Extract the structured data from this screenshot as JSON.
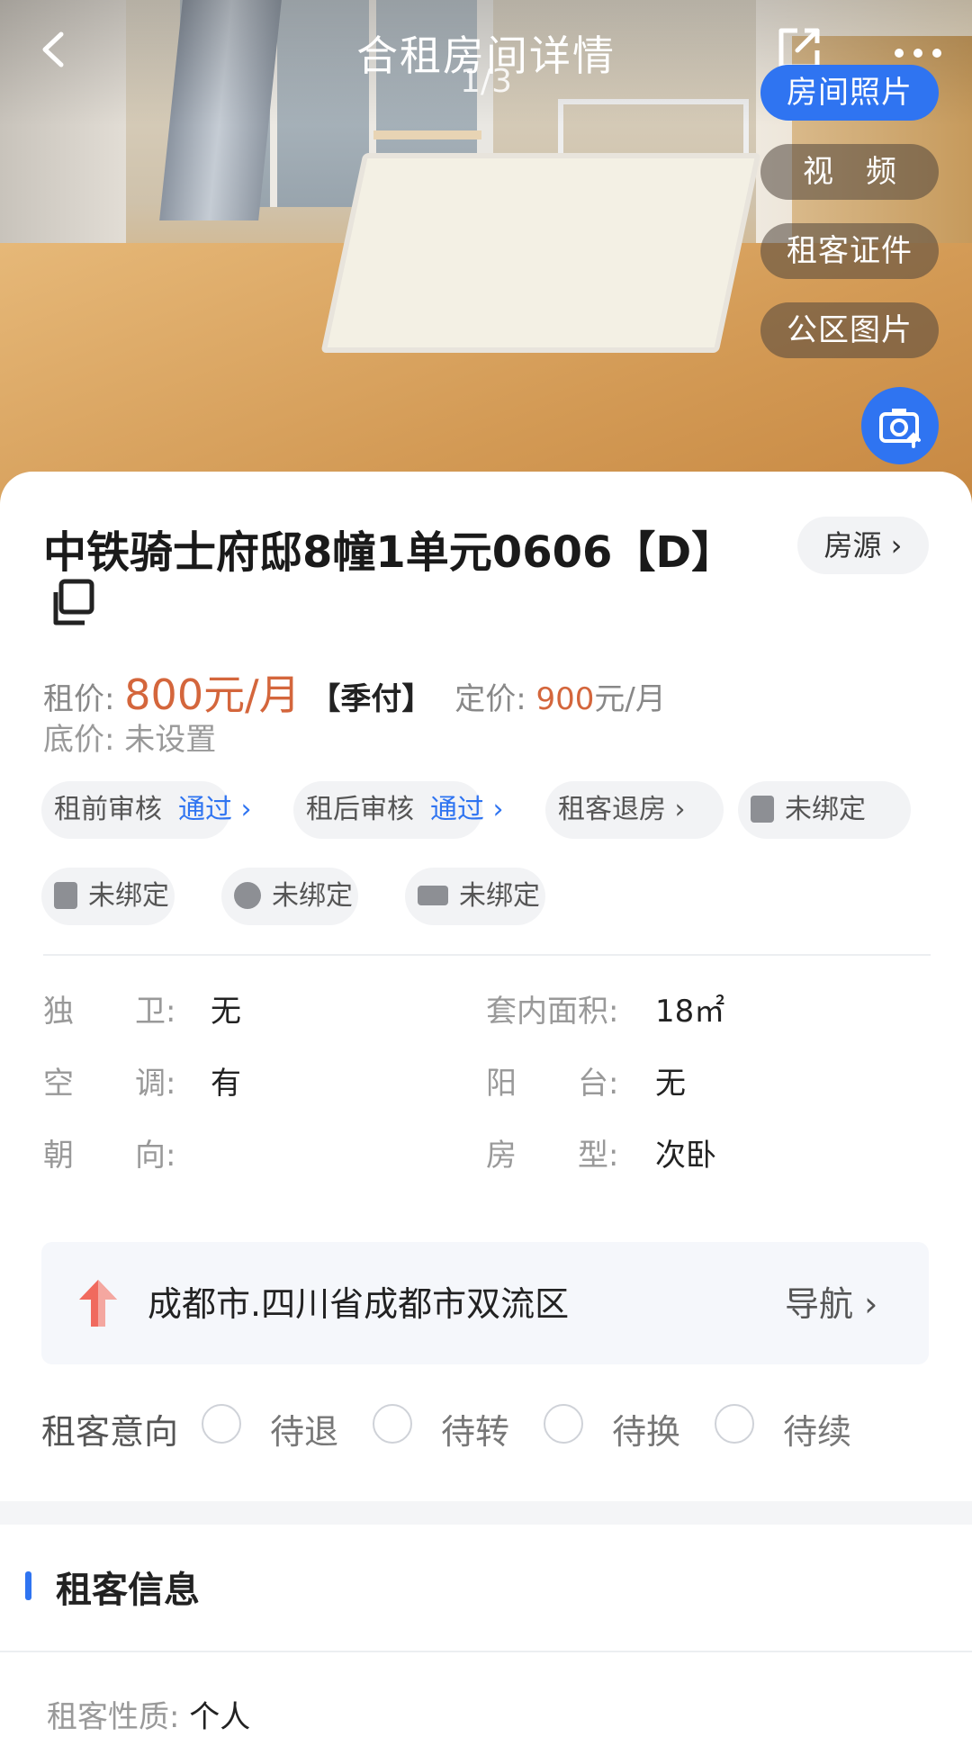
{
  "header": {
    "title": "合租房间详情",
    "counter": "1/3"
  },
  "media_tabs": [
    {
      "label": "房间照片",
      "active": true
    },
    {
      "label": "视频",
      "active": false
    },
    {
      "label": "租客证件",
      "active": false
    },
    {
      "label": "公区图片",
      "active": false
    }
  ],
  "room": {
    "name": "中铁骑士府邸8幢1单元0606【D】",
    "source_label": "房源 ›"
  },
  "price": {
    "rent_label": "租价:",
    "rent_value": "800元/月",
    "pay_cycle": "【季付】",
    "fixed_label": "定价:",
    "fixed_value": "900",
    "fixed_unit": "元/月",
    "floor_label": "底价:",
    "floor_value": "未设置"
  },
  "chips": {
    "pre_review": {
      "label": "租前审核",
      "status": "通过 ›"
    },
    "post_review": {
      "label": "租后审核",
      "status": "通过 ›"
    },
    "checkout": {
      "label": "租客退房 ›"
    },
    "meter1": {
      "label": "未绑定"
    },
    "meter2": {
      "label": "未绑定"
    },
    "meter3": {
      "label": "未绑定"
    },
    "meter4": {
      "label": "未绑定"
    }
  },
  "attributes": {
    "bathroom": {
      "label": "独　　卫:",
      "value": "无"
    },
    "area": {
      "label": "套内面积:",
      "value": "18㎡"
    },
    "aircon": {
      "label": "空　　调:",
      "value": "有"
    },
    "balcony": {
      "label": "阳　　台:",
      "value": "无"
    },
    "orientation": {
      "label": "朝　　向:",
      "value": ""
    },
    "room_type": {
      "label": "房　　型:",
      "value": "次卧"
    }
  },
  "address": {
    "text": "成都市.四川省成都市双流区",
    "nav_label": "导航 ›"
  },
  "intent": {
    "label": "租客意向",
    "options": [
      "待退",
      "待转",
      "待换",
      "待续"
    ]
  },
  "tenant_section": {
    "title": "租客信息",
    "type_label": "租客性质:",
    "type_value": "个人"
  },
  "colors": {
    "accent_blue": "#2f74f1",
    "price_orange": "#d4663c"
  }
}
